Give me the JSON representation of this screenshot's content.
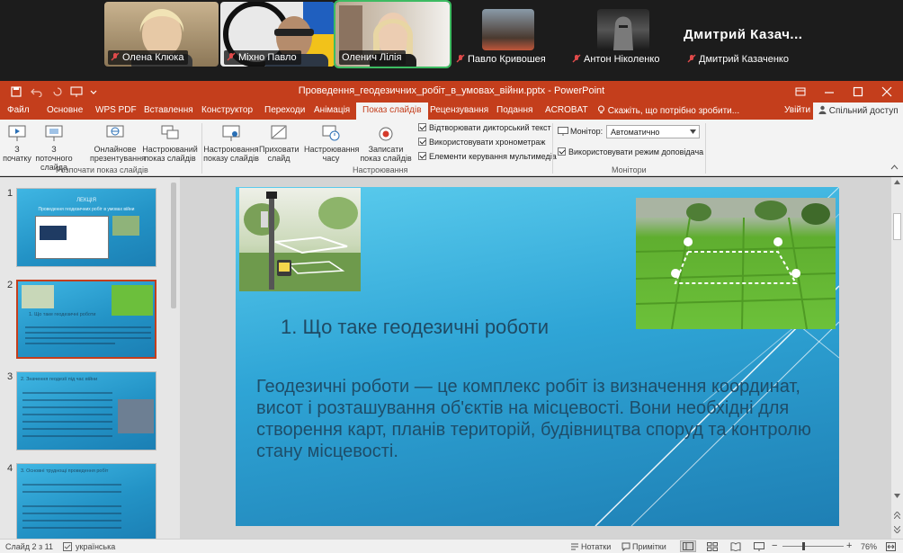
{
  "participants": [
    {
      "name": "Олена Клюка",
      "muted": true
    },
    {
      "name": "Міхно Павло",
      "muted": true
    },
    {
      "name": "Оленич Лілія",
      "muted": false
    },
    {
      "name": "Павло Кривошея",
      "muted": true
    },
    {
      "name": "Антон Ніколенко",
      "muted": true
    },
    {
      "name": "Дмитрий Казаченко",
      "muted": true
    }
  ],
  "big_name": "Дмитрий  Казач...",
  "app": {
    "title": "Проведення_геодезичних_робіт_в_умовах_війни.pptx - PowerPoint",
    "tabs": [
      "Файл",
      "Основне",
      "WPS PDF",
      "Вставлення",
      "Конструктор",
      "Переходи",
      "Анімація",
      "Показ слайдів",
      "Рецензування",
      "Подання",
      "ACROBAT"
    ],
    "active_tab": "Показ слайдів",
    "tell_me": "Скажіть, що потрібно зробити...",
    "sign_in": "Увійти",
    "share": "Спільний доступ"
  },
  "ribbon": {
    "start": {
      "from_beginning": "З початку",
      "from_current": "З поточного слайда",
      "online": "Онлайнове презентування",
      "custom": "Настроюваний показ слайдів",
      "group_label": "Розпочати показ слайдів"
    },
    "setup": {
      "setup_show": "Настроювання показу слайдів",
      "hide_slide": "Приховати слайд",
      "rehearse": "Настроювання часу",
      "record": "Записати показ слайдів",
      "play_narrations": "Відтворювати дикторський текст",
      "use_timings": "Використовувати хронометраж",
      "show_media": "Елементи керування мультимедіа",
      "group_label": "Настроювання"
    },
    "monitors": {
      "monitor_label": "Монітор:",
      "monitor_value": "Автоматично",
      "presenter_view": "Використовувати режим доповідача",
      "group_label": "Монітори"
    }
  },
  "thumbnails": [
    {
      "num": "1",
      "title": "ЛЕКЦІЯ",
      "subtitle": "Проведення геодезичних робіт в умовах війни"
    },
    {
      "num": "2",
      "title": "1. Що таке геодезичні роботи"
    },
    {
      "num": "3",
      "title": "2. Значення геодезії під час війни"
    },
    {
      "num": "4",
      "title": "3. Основні труднощі проведення робіт"
    }
  ],
  "slide": {
    "title": "1. Що таке геодезичні роботи",
    "body": "Геодезичні роботи — це комплекс робіт із визначення координат, висот і розташування об'єктів на місцевості. Вони необхідні для створення карт, планів територій, будівництва споруд та контролю стану місцевості."
  },
  "status": {
    "slide_info": "Слайд 2 з 11",
    "language": "українська",
    "notes": "Нотатки",
    "comments": "Примітки",
    "zoom": "76%"
  },
  "colors": {
    "accent": "#c43e1c",
    "slide_bg": "#2fa5d6",
    "speaker_outline": "#3dbb62"
  }
}
